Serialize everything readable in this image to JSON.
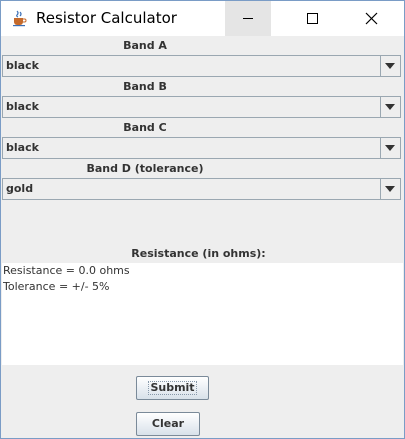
{
  "window": {
    "title": "Resistor Calculator"
  },
  "bands": [
    {
      "label": "Band A",
      "value": "black"
    },
    {
      "label": "Band B",
      "value": "black"
    },
    {
      "label": "Band C",
      "value": "black"
    },
    {
      "label": "Band D (tolerance)",
      "value": "gold"
    }
  ],
  "result": {
    "label": "Resistance (in ohms):",
    "line1": "Resistance = 0.0 ohms",
    "line2": "Tolerance = +/- 5%"
  },
  "buttons": {
    "submit": "Submit",
    "clear": "Clear"
  },
  "icons": {
    "app": "java-cup-icon",
    "minimize": "minimize-icon",
    "maximize": "maximize-icon",
    "close": "close-icon",
    "dropdown": "triangle-down-icon"
  }
}
